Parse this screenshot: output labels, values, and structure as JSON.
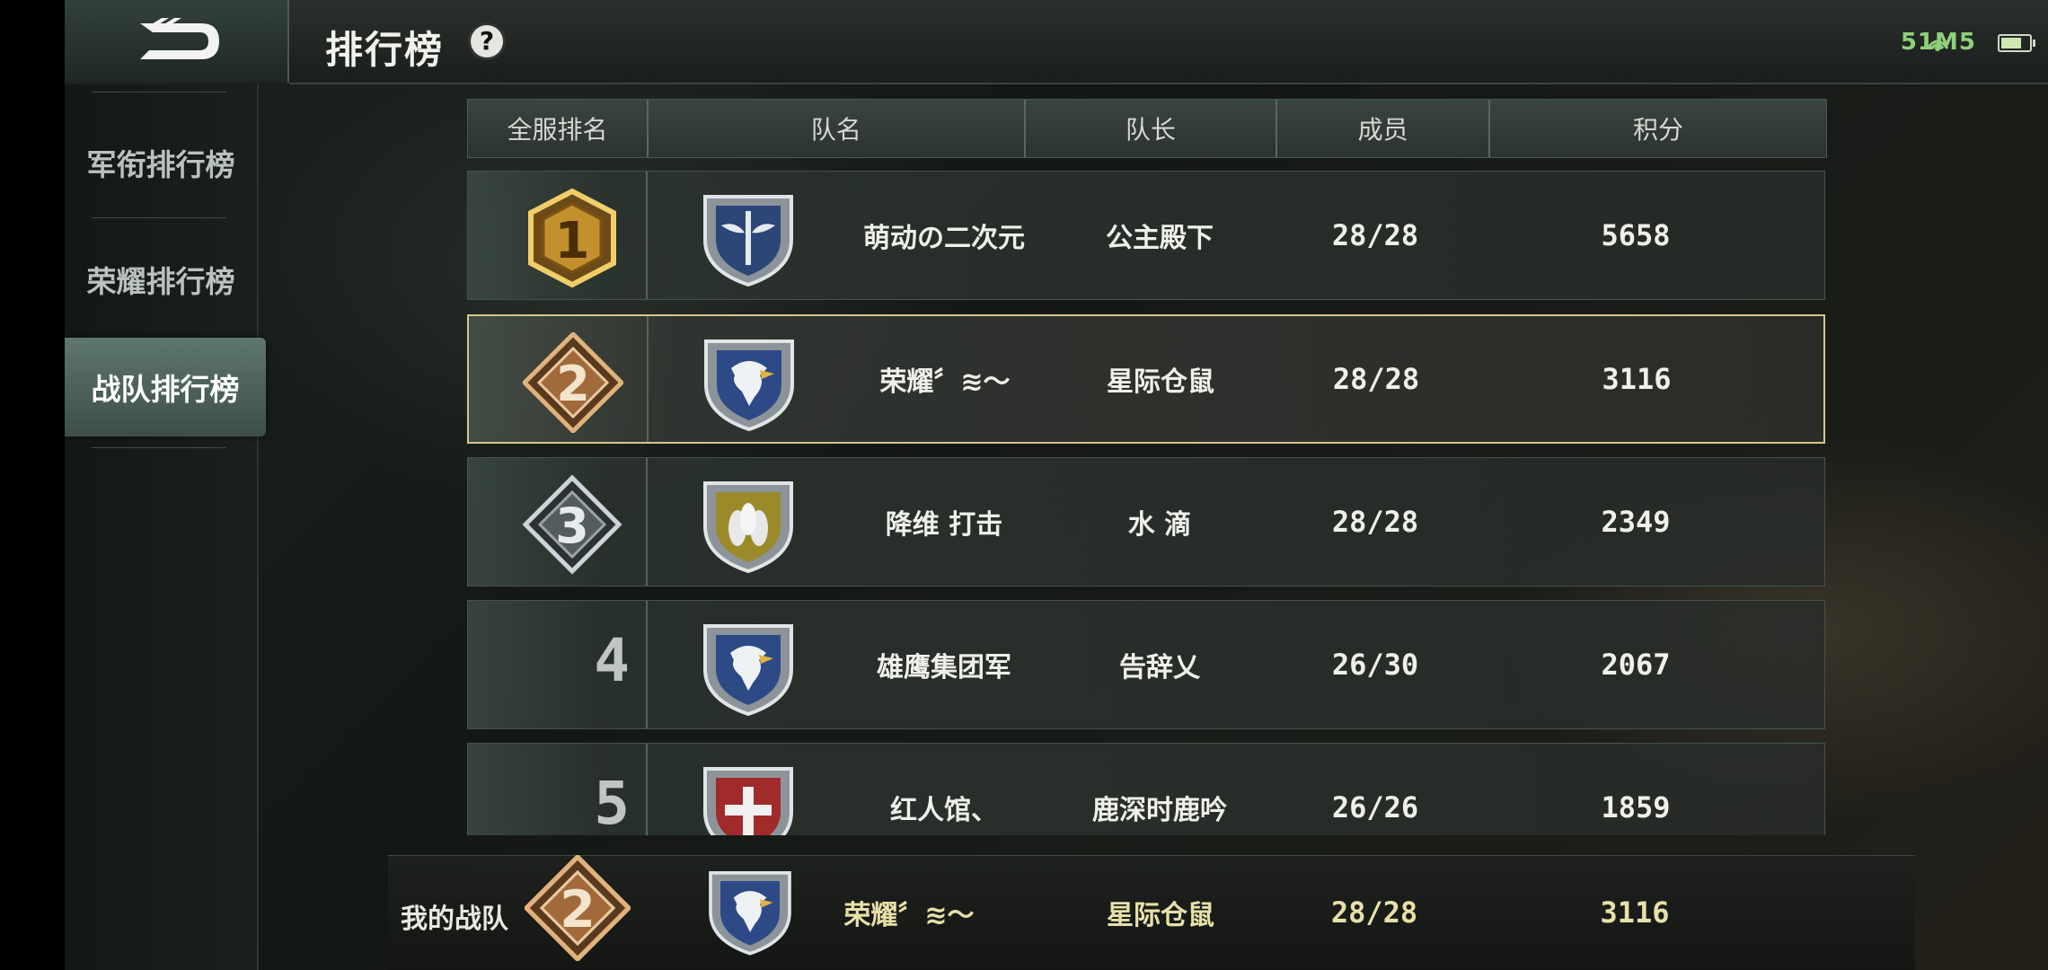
{
  "header": {
    "title": "排行榜",
    "help": "?",
    "signal": "51M5"
  },
  "sidebar": {
    "items": [
      {
        "label": "军衔排行榜",
        "active": false
      },
      {
        "label": "荣耀排行榜",
        "active": false
      },
      {
        "label": "战队排行榜",
        "active": true
      }
    ]
  },
  "table": {
    "headers": [
      "全服排名",
      "队名",
      "队长",
      "成员",
      "积分"
    ],
    "rows": [
      {
        "rank": "1",
        "team": "萌动の二次元",
        "captain": "公主殿下",
        "members": "28/28",
        "score": "5658",
        "medal": "gold",
        "emblem": "sword-wings"
      },
      {
        "rank": "2",
        "team": "荣耀〞≋〜",
        "captain": "星际仓鼠",
        "members": "28/28",
        "score": "3116",
        "medal": "bronze",
        "emblem": "eagle-blue"
      },
      {
        "rank": "3",
        "team": "降维 打击",
        "captain": "水 滴",
        "members": "28/28",
        "score": "2349",
        "medal": "silver",
        "emblem": "bombs-gold"
      },
      {
        "rank": "4",
        "team": "雄鹰集团军",
        "captain": "告辞乂",
        "members": "26/30",
        "score": "2067",
        "medal": "none",
        "emblem": "eagle-blue"
      },
      {
        "rank": "5",
        "team": "红人馆、",
        "captain": "鹿深时鹿吟",
        "members": "26/26",
        "score": "1859",
        "medal": "none",
        "emblem": "cross-red"
      }
    ]
  },
  "my_team": {
    "label": "我的战队",
    "rank": "2",
    "team": "荣耀〞≋〜",
    "captain": "星际仓鼠",
    "members": "28/28",
    "score": "3116"
  },
  "colors": {
    "gold": "#d9a94a",
    "bronze": "#b07a45",
    "silver": "#b8c0c4",
    "emblem_blue": "#2e4a86",
    "emblem_gold": "#9b8a2a",
    "emblem_red": "#a12a2a",
    "highlight": "#d9c58a"
  }
}
